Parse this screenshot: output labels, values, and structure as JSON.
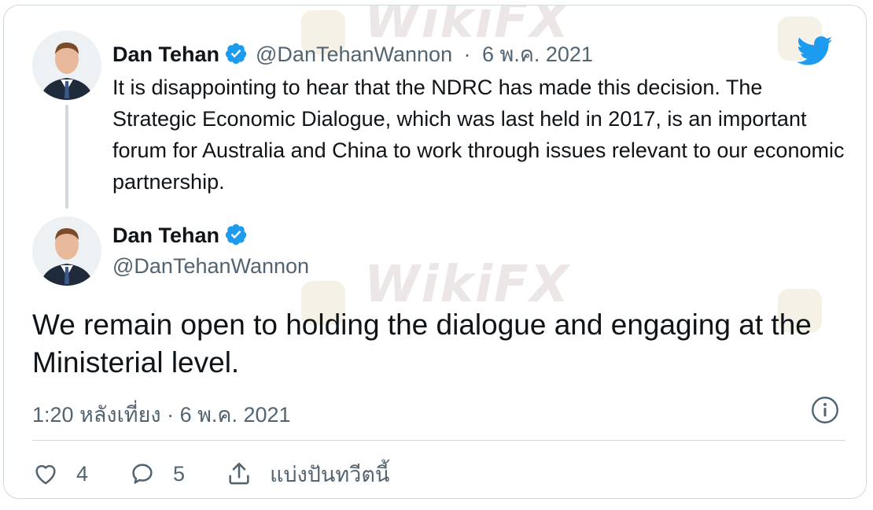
{
  "quoted_tweet": {
    "name": "Dan Tehan",
    "handle": "@DanTehanWannon",
    "separator": "·",
    "date": "6 พ.ค. 2021",
    "text": "It is disappointing to hear that the NDRC has made this decision. The Strategic Economic Dialogue, which was last held in 2017, is an important forum for Australia and China to work through issues relevant to our economic partnership."
  },
  "main_tweet": {
    "name": "Dan Tehan",
    "handle": "@DanTehanWannon",
    "text": "We remain open to holding the dialogue and engaging at the Ministerial level.",
    "timestamp": "1:20 หลังเที่ยง · 6 พ.ค. 2021"
  },
  "actions": {
    "likes": "4",
    "replies": "5",
    "share_label": "แบ่งปันทวีตนี้"
  },
  "watermark": {
    "text": "WikiFX"
  },
  "colors": {
    "brand_blue": "#1d9bf0",
    "muted": "#536471",
    "border": "#cfd9de"
  },
  "icons": [
    "verified-badge-icon",
    "twitter-bird-icon",
    "info-icon",
    "heart-icon",
    "reply-icon",
    "share-icon"
  ]
}
